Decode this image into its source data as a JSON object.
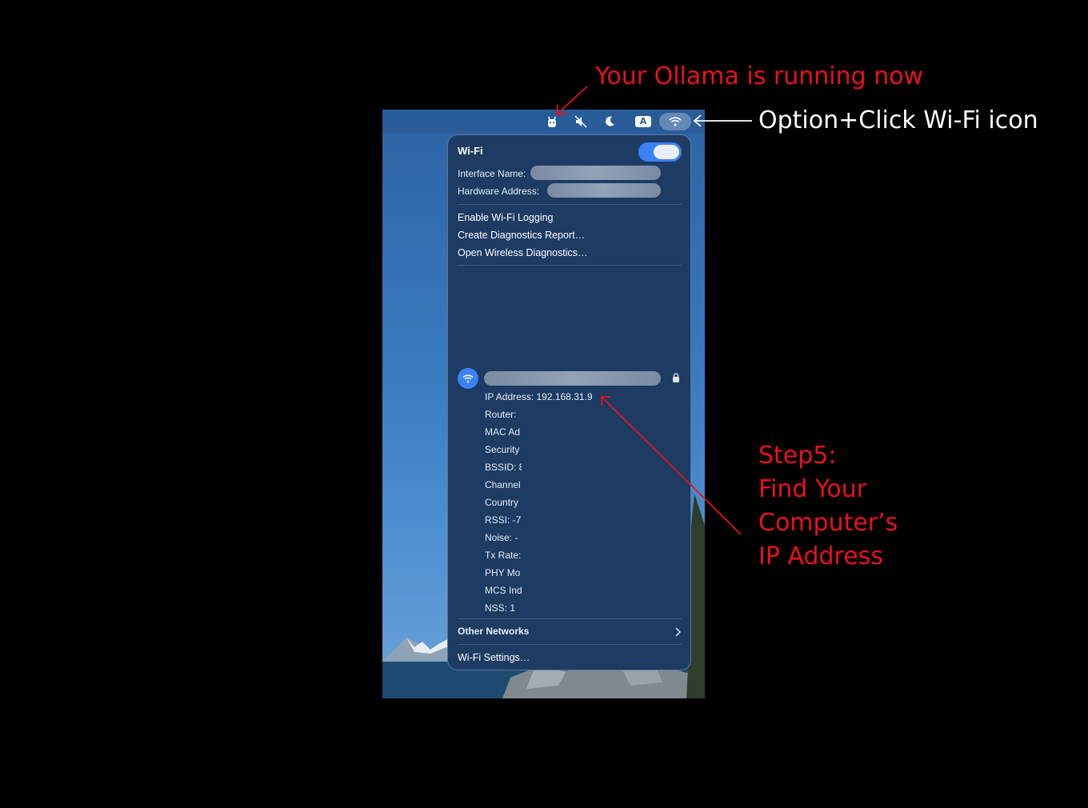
{
  "annotations": {
    "ollama_running": "Your Ollama is running now",
    "option_click": "Option+Click Wi-Fi icon",
    "step5_lines": [
      "Step5:",
      "Find Your",
      "Computer’s",
      "IP Address"
    ]
  },
  "menubar": {
    "icons": [
      "ollama-icon",
      "mute-icon",
      "moon-icon",
      "input-source-icon",
      "wifi-icon"
    ],
    "input_source_label": "A"
  },
  "wifi_panel": {
    "title": "Wi-Fi",
    "toggle_on": true,
    "interface_name_label": "Interface Name:",
    "hardware_address_label": "Hardware Address:",
    "menu_items": [
      "Enable Wi-Fi Logging",
      "Create Diagnostics Report…",
      "Open Wireless Diagnostics…"
    ],
    "network_details": [
      "IP Address: 192.168.31.9",
      "Router: ",
      "MAC Ad",
      "Security",
      "BSSID: 8",
      "Channel",
      "Country",
      "RSSI: -7",
      "Noise: -",
      "Tx Rate:",
      "PHY Mo",
      "MCS Ind",
      "NSS: 1"
    ],
    "other_networks": "Other Networks",
    "settings_link": "Wi-Fi Settings…"
  },
  "colors": {
    "annotation_red": "#e8121b",
    "toggle_blue": "#3b82f6",
    "panel_bg": "#1d3b63"
  }
}
